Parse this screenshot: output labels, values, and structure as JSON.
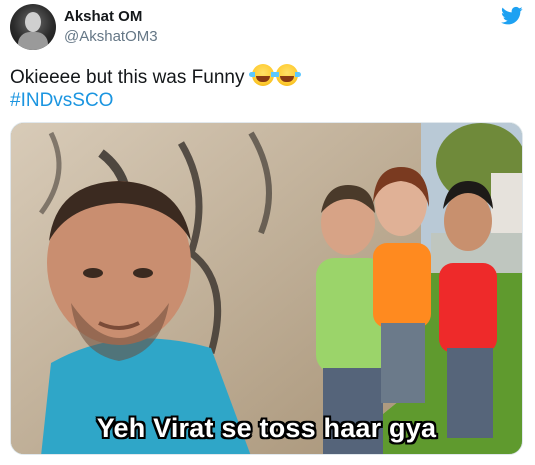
{
  "user": {
    "display_name": "Akshat OM",
    "handle": "@AkshatOM3"
  },
  "tweet": {
    "text": "Okieeee but this was Funny",
    "emoji": [
      "laughing-tears",
      "laughing-tears"
    ],
    "hashtag": "#INDvsSCO"
  },
  "media": {
    "caption": "Yeh Virat se toss haar gya"
  },
  "colors": {
    "link": "#1b95e0",
    "twitter_brand": "#1da1f2",
    "text": "#14171a",
    "muted": "#657786"
  },
  "icons": [
    "twitter-bird-icon"
  ]
}
